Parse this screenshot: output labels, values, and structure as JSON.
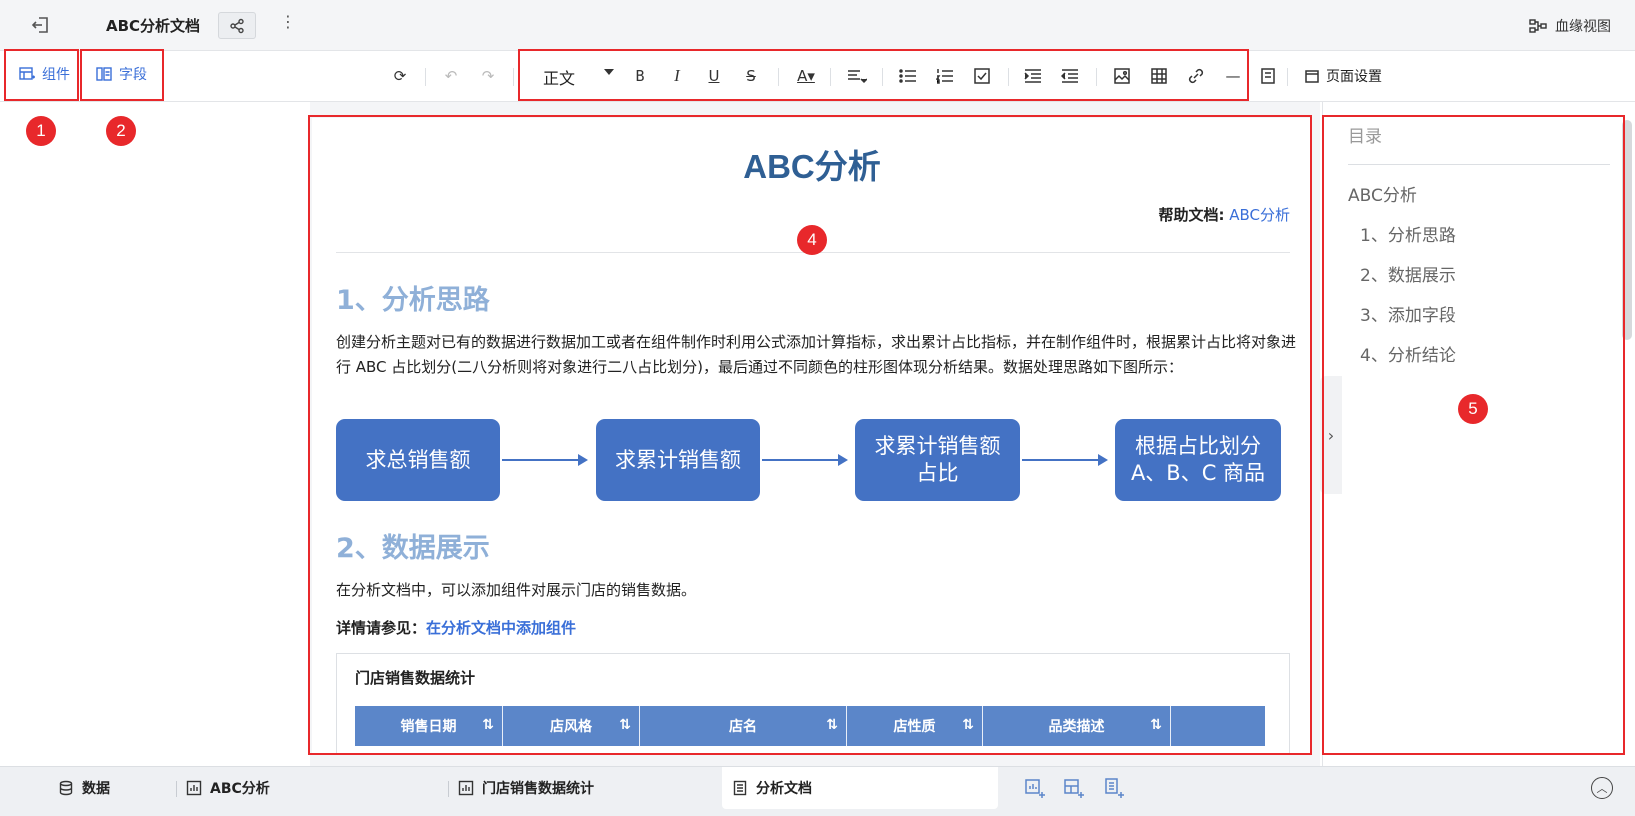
{
  "topbar": {
    "title": "ABC分析文档",
    "more": "⋮",
    "lineage_label": "血缘视图"
  },
  "toolbar": {
    "component_label": "组件",
    "field_label": "字段",
    "text_style": "正文",
    "page_setting_label": "页面设置"
  },
  "markers": [
    "1",
    "2",
    "4",
    "5"
  ],
  "document": {
    "title": "ABC分析",
    "help_label": "帮助文档:",
    "help_link": "ABC分析",
    "section1_title": "1、分析思路",
    "section1_text": "创建分析主题对已有的数据进行数据加工或者在组件制作时利用公式添加计算指标，求出累计占比指标，并在制作组件时，根据累计占比将对象进行 ABC 占比划分(二八分析则将对象进行二八占比划分)，最后通过不同颜色的柱形图体现分析结果。数据处理思路如下图所示：",
    "flow": [
      "求总销售额",
      "求累计销售额",
      "求累计销售额\n占比",
      "根据占比划分\nA、B、C 商品"
    ],
    "section2_title": "2、数据展示",
    "section2_text": "在分析文档中，可以添加组件对展示门店的销售数据。",
    "see_label": "详情请参见：",
    "see_link": "在分析文档中添加组件",
    "widget_title": "门店销售数据统计",
    "table_headers": [
      "销售日期",
      "店风格",
      "店名",
      "店性质",
      "品类描述",
      ""
    ]
  },
  "toc": {
    "title": "目录",
    "items": [
      "ABC分析",
      "1、分析思路",
      "2、数据展示",
      "3、添加字段",
      "4、分析结论"
    ]
  },
  "bottom_tabs": [
    "数据",
    "ABC分析",
    "门店销售数据统计",
    "分析文档"
  ],
  "colors": {
    "accent": "#3a6fd8",
    "flow_box": "#4472c4",
    "table_header": "#5b86c9",
    "marker_red": "#e8282b",
    "doc_title": "#2f5f94",
    "section_title": "#8fb0d8"
  }
}
